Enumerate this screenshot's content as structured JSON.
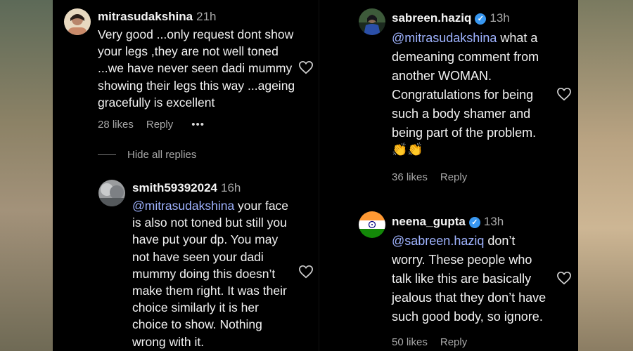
{
  "comments": [
    {
      "username": "mitrasudakshina",
      "time": "21h",
      "text": "Very good ...only request dont show your legs ,they are not well toned ...we have never seen dadi mummy showing their legs this way ...ageing gracefully is excellent",
      "likes": "28 likes",
      "reply_label": "Reply",
      "more_label": "•••"
    },
    {
      "username": "smith59392024",
      "time": "16h",
      "mention": "@mitrasudakshina",
      "text": " your face is also not toned but still you have put your dp. You may not have seen your dadi mummy doing this doesn’t make them right. It was their choice similarly it is her choice to show. Nothing wrong with it."
    },
    {
      "username": "sabreen.haziq",
      "time": "13h",
      "mention": "@mitrasudakshina",
      "text": " what a demeaning comment from another WOMAN. Congratulations for being such a body shamer and being part of the problem.",
      "emoji": "👏👏",
      "likes": "36 likes",
      "reply_label": "Reply",
      "verified": true
    },
    {
      "username": "neena_gupta",
      "time": "13h",
      "mention": "@sabreen.haziq",
      "text": " don’t worry. These people who talk like this are basically jealous that they don’t have such good body, so ignore.",
      "likes": "50 likes",
      "reply_label": "Reply",
      "verified": true
    }
  ],
  "hide_replies_label": "Hide all replies",
  "colors": {
    "background": "#000000",
    "mention": "#9fb3ff",
    "muted": "#a8a8a8",
    "verified": "#3897f0"
  },
  "icons": [
    "heart-icon",
    "verified-badge-icon",
    "more-icon",
    "clap-emoji"
  ]
}
